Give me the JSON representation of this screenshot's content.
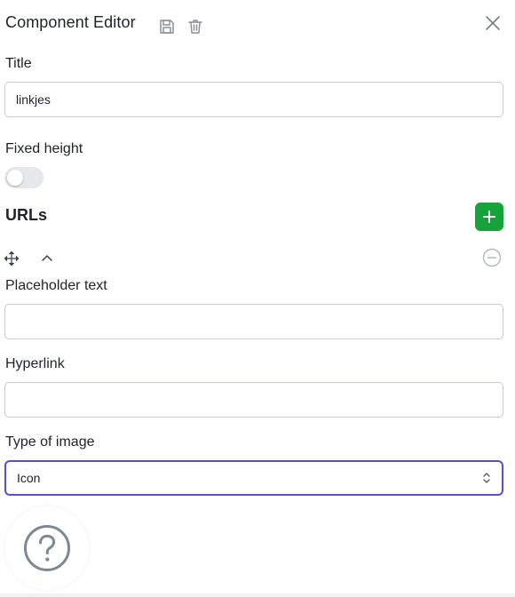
{
  "header": {
    "title": "Component Editor",
    "icons": [
      "save-icon",
      "trash-icon"
    ],
    "close_icon": "close-icon"
  },
  "form": {
    "title_label": "Title",
    "title_value": "linkjes",
    "fixed_height_label": "Fixed height",
    "fixed_height_on": false,
    "urls_title": "URLs",
    "add_icon": "plus-icon",
    "item_controls": [
      "move-icon",
      "chevron-up-icon",
      "remove-icon"
    ],
    "placeholder_label": "Placeholder text",
    "placeholder_value": "",
    "hyperlink_label": "Hyperlink",
    "hyperlink_value": "",
    "image_type_label": "Type of image",
    "image_type_value": "Icon"
  },
  "help": {
    "icon": "question-icon"
  },
  "colors": {
    "accent_green": "#15a33a",
    "focus_purple": "#5b4fd1",
    "icon_gray": "#6b7280"
  }
}
